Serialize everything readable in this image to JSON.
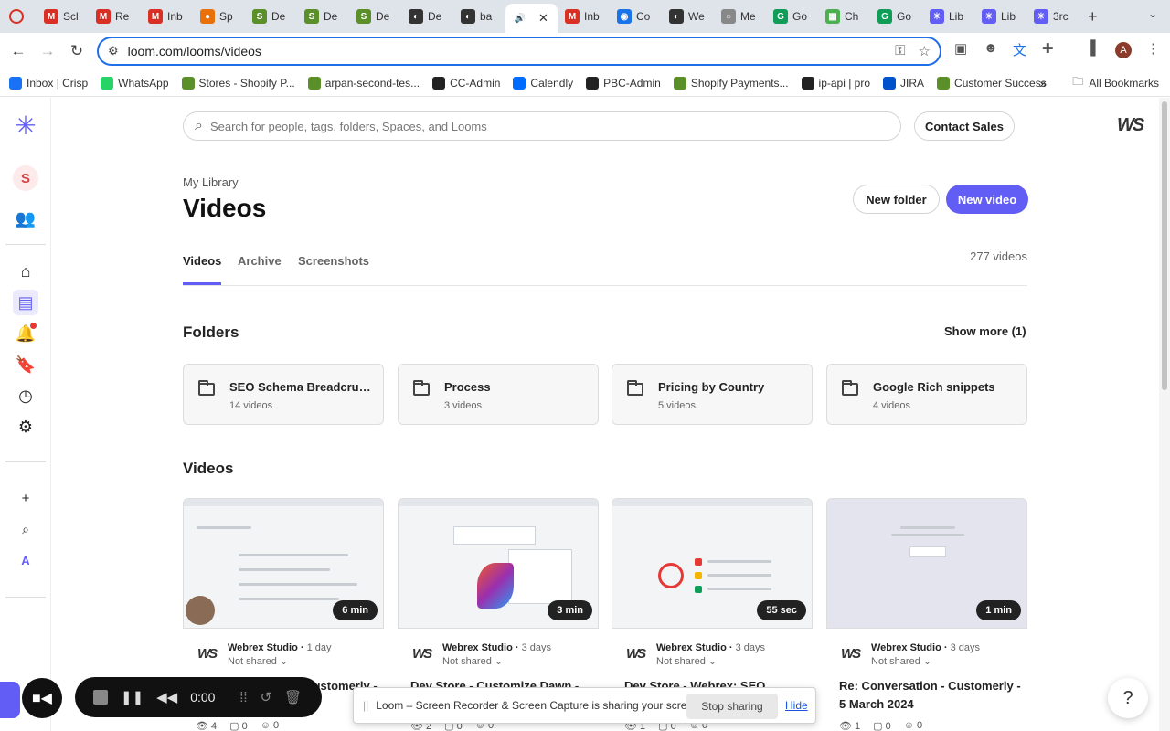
{
  "browser": {
    "tabs": [
      {
        "label": "Scl",
        "fav": "M",
        "color": "#d93025"
      },
      {
        "label": "Re",
        "fav": "M",
        "color": "#d93025"
      },
      {
        "label": "Inb",
        "fav": "M",
        "color": "#d93025"
      },
      {
        "label": "Sp",
        "fav": "●",
        "color": "#e8710a"
      },
      {
        "label": "De",
        "fav": "S",
        "color": "#5a8f29"
      },
      {
        "label": "De",
        "fav": "S",
        "color": "#5a8f29"
      },
      {
        "label": "De",
        "fav": "S",
        "color": "#5a8f29"
      },
      {
        "label": "De",
        "fav": "◐",
        "color": "#333333"
      },
      {
        "label": "ba",
        "fav": "◐",
        "color": "#333333"
      },
      {
        "label": "",
        "fav": "🔊",
        "color": "#ffffff",
        "active": true
      },
      {
        "label": "Inb",
        "fav": "M",
        "color": "#d93025"
      },
      {
        "label": "Co",
        "fav": "◉",
        "color": "#1a73e8"
      },
      {
        "label": "We",
        "fav": "◐",
        "color": "#333333"
      },
      {
        "label": "Me",
        "fav": "○",
        "color": "#888888"
      },
      {
        "label": "Go",
        "fav": "G",
        "color": "#0f9d58"
      },
      {
        "label": "Ch",
        "fav": "▦",
        "color": "#4caf50"
      },
      {
        "label": "Go",
        "fav": "G",
        "color": "#0f9d58"
      },
      {
        "label": "Lib",
        "fav": "✳",
        "color": "#625df5"
      },
      {
        "label": "Lib",
        "fav": "✳",
        "color": "#625df5"
      },
      {
        "label": "3rc",
        "fav": "✳",
        "color": "#625df5"
      }
    ],
    "url": "loom.com/looms/videos",
    "bookmarks": [
      {
        "label": "Inbox | Crisp",
        "color": "#1972f5"
      },
      {
        "label": "WhatsApp",
        "color": "#25d366"
      },
      {
        "label": "Stores - Shopify P...",
        "color": "#5a8f29"
      },
      {
        "label": "arpan-second-tes...",
        "color": "#5a8f29"
      },
      {
        "label": "CC-Admin",
        "color": "#222222"
      },
      {
        "label": "Calendly",
        "color": "#006bff"
      },
      {
        "label": "PBC-Admin",
        "color": "#222222"
      },
      {
        "label": "Shopify Payments...",
        "color": "#5a8f29"
      },
      {
        "label": "ip-api | pro",
        "color": "#222222"
      },
      {
        "label": "JIRA",
        "color": "#0052cc"
      },
      {
        "label": "Customer Success",
        "color": "#5a8f29"
      }
    ],
    "all_bookmarks": "All Bookmarks",
    "more": "»"
  },
  "search": {
    "placeholder": "Search for people, tags, folders, Spaces, and Looms"
  },
  "header": {
    "contact_sales": "Contact Sales",
    "logo": "WS"
  },
  "page": {
    "breadcrumb": "My Library",
    "title": "Videos",
    "new_folder": "New folder",
    "new_video": "New video",
    "tabs": [
      "Videos",
      "Archive",
      "Screenshots"
    ],
    "count": "277 videos"
  },
  "folders_section": {
    "title": "Folders",
    "show_more": "Show more (1)",
    "items": [
      {
        "name": "SEO Schema Breadcrumbs",
        "count": "14 videos"
      },
      {
        "name": "Process",
        "count": "3 videos"
      },
      {
        "name": "Pricing by Country",
        "count": "5 videos"
      },
      {
        "name": "Google Rich snippets",
        "count": "4 videos"
      }
    ]
  },
  "videos_section": {
    "title": "Videos",
    "items": [
      {
        "duration": "6 min",
        "owner": "Webrex Studio",
        "ago": "1 day",
        "shared": "Not shared",
        "title": "Re: Conversation - Customerly - 7",
        "views": "4",
        "comments": "0",
        "reactions": "0"
      },
      {
        "duration": "3 min",
        "owner": "Webrex Studio",
        "ago": "3 days",
        "shared": "Not shared",
        "title": "Dev Store - Customize Dawn -",
        "views": "2",
        "comments": "0",
        "reactions": "0"
      },
      {
        "duration": "55 sec",
        "owner": "Webrex Studio",
        "ago": "3 days",
        "shared": "Not shared",
        "title": "Dev Store - Webrex: SEO",
        "views": "1",
        "comments": "0",
        "reactions": "0"
      },
      {
        "duration": "1 min",
        "owner": "Webrex Studio",
        "ago": "3 days",
        "shared": "Not shared",
        "title": "Re: Conversation - Customerly - 5 March 2024",
        "views": "1",
        "comments": "0",
        "reactions": "0"
      }
    ]
  },
  "recorder": {
    "time": "0:00"
  },
  "share_banner": {
    "message": "Loom – Screen Recorder & Screen Capture is sharing your screen.",
    "stop": "Stop sharing",
    "hide": "Hide"
  },
  "sidebar": {
    "avatar_letter": "S",
    "workspace_letter": "A"
  },
  "profile": {
    "letter": "A"
  },
  "colors": {
    "accent": "#625df5",
    "notification": "#e53935"
  }
}
